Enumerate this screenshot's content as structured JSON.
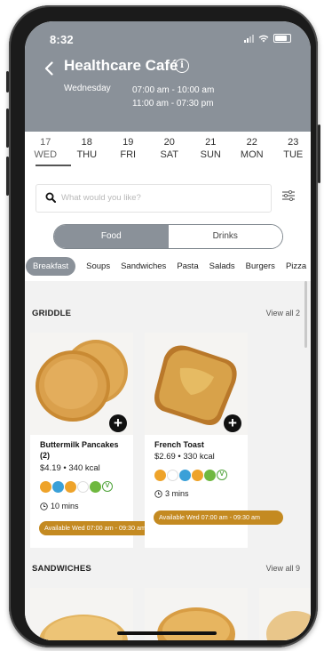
{
  "status": {
    "time": "8:32"
  },
  "header": {
    "title": "Healthcare Café",
    "day": "Wednesday",
    "hours": [
      "07:00 am - 10:00 am",
      "11:00 am - 07:30 pm"
    ]
  },
  "dates": [
    {
      "num": "17",
      "day": "WED"
    },
    {
      "num": "18",
      "day": "THU"
    },
    {
      "num": "19",
      "day": "FRI"
    },
    {
      "num": "20",
      "day": "SAT"
    },
    {
      "num": "21",
      "day": "SUN"
    },
    {
      "num": "22",
      "day": "MON"
    },
    {
      "num": "23",
      "day": "TUE"
    }
  ],
  "search": {
    "placeholder": "What would you like?"
  },
  "segment": {
    "food": "Food",
    "drinks": "Drinks"
  },
  "categories": [
    "Breakfast",
    "Soups",
    "Sandwiches",
    "Pasta",
    "Salads",
    "Burgers",
    "Pizza"
  ],
  "sections": {
    "griddle": {
      "title": "GRIDDLE",
      "view_all": "View all 2",
      "items": [
        {
          "name": "Buttermilk Pancakes (2)",
          "price": "$4.19",
          "kcal": "340 kcal",
          "time": "10 mins",
          "available": "Available Wed 07:00 am - 09:30 am"
        },
        {
          "name": "French Toast",
          "price": "$2.69",
          "kcal": "330 kcal",
          "time": "3 mins",
          "available": "Available Wed 07:00 am - 09:30 am"
        }
      ]
    },
    "sandwiches": {
      "title": "SANDWICHES",
      "view_all": "View all 9"
    }
  },
  "colors": {
    "header": "#8a9199",
    "available": "#c48a21"
  }
}
